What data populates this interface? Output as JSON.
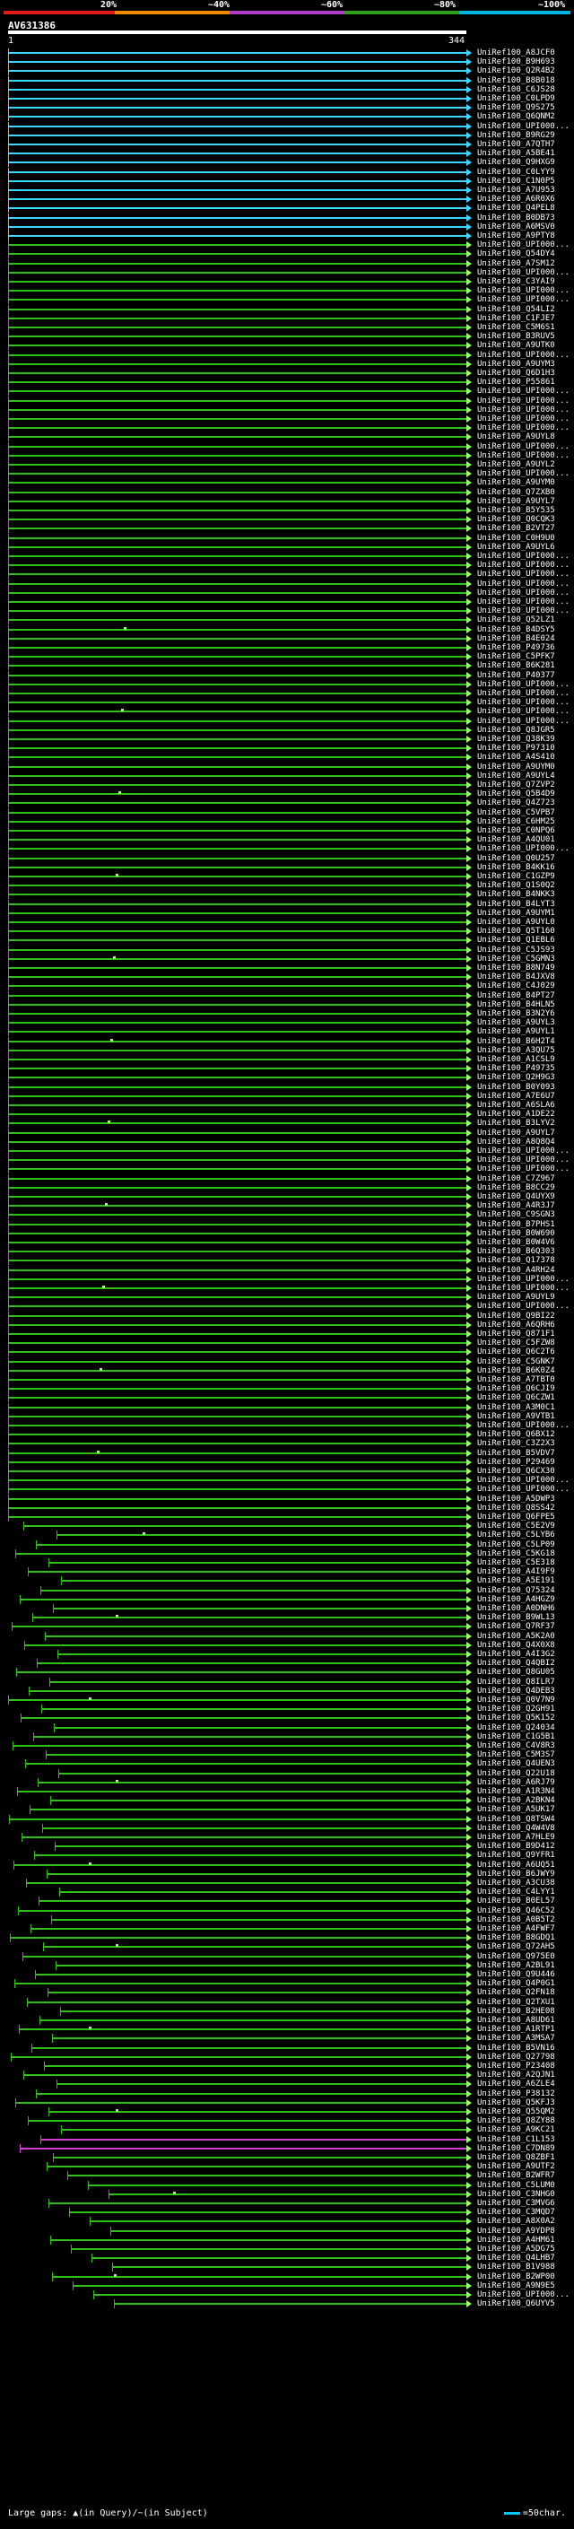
{
  "scale": {
    "labels": [
      "20%",
      "~40%",
      "~60%",
      "~80%",
      "~100%"
    ],
    "colors": [
      "#e11a1a",
      "#f08a00",
      "#b03cc8",
      "#2fa01b",
      "#00b4e0"
    ]
  },
  "query": {
    "name": "AV631386",
    "start": "1",
    "end": "344"
  },
  "colors": {
    "hit_cyan": "#3cd6ff",
    "hit_green": "#2fbf18",
    "hit_magenta": "#d23cd2",
    "arrow": "#9cff6c",
    "tick": "#ffffff"
  },
  "hits": [
    "UniRef100_A8JCF0",
    "UniRef100_B9H693",
    "UniRef100_Q2R4B2",
    "UniRef100_B8B018",
    "UniRef100_C6JS28",
    "UniRef100_C0LPD9",
    "UniRef100_Q9S275",
    "UniRef100_Q6QNM2",
    "UniRef100_UPI000...",
    "UniRef100_B9RG29",
    "UniRef100_A7QTH7",
    "UniRef100_A5BE41",
    "UniRef100_Q9HXG9",
    "UniRef100_C0LYY9",
    "UniRef100_C1N0P5",
    "UniRef100_A7U953",
    "UniRef100_A6R0X6",
    "UniRef100_Q4PEL8",
    "UniRef100_B0DB73",
    "UniRef100_A6MSV0",
    "UniRef100_A9PTY8",
    "UniRef100_UPI000...",
    "UniRef100_Q54DY4",
    "UniRef100_A7SM12",
    "UniRef100_UPI000...",
    "UniRef100_C3YAI9",
    "UniRef100_UPI000...",
    "UniRef100_UPI000...",
    "UniRef100_Q54LI2",
    "UniRef100_C1FJE7",
    "UniRef100_C5M6S1",
    "UniRef100_B3RUV5",
    "UniRef100_A9UTK0",
    "UniRef100_UPI000...",
    "UniRef100_A9UYM3",
    "UniRef100_Q6D1H3",
    "UniRef100_P55861",
    "UniRef100_UPI000...",
    "UniRef100_UPI000...",
    "UniRef100_UPI000...",
    "UniRef100_UPI000...",
    "UniRef100_UPI000...",
    "UniRef100_A9UYL8",
    "UniRef100_UPI000...",
    "UniRef100_UPI000...",
    "UniRef100_A9UYL2",
    "UniRef100_UPI000...",
    "UniRef100_A9UYM0",
    "UniRef100_Q7ZXB0",
    "UniRef100_A9UYL7",
    "UniRef100_B5Y535",
    "UniRef100_Q0CQK3",
    "UniRef100_B2VT27",
    "UniRef100_C0H9U0",
    "UniRef100_A9UYL6",
    "UniRef100_UPI000...",
    "UniRef100_UPI000...",
    "UniRef100_UPI000...",
    "UniRef100_UPI000...",
    "UniRef100_UPI000...",
    "UniRef100_UPI000...",
    "UniRef100_UPI000...",
    "UniRef100_Q52LZ1",
    "UniRef100_B4DSY5",
    "UniRef100_B4E024",
    "UniRef100_P49736",
    "UniRef100_C5PFK7",
    "UniRef100_B6K281",
    "UniRef100_P40377",
    "UniRef100_UPI000...",
    "UniRef100_UPI000...",
    "UniRef100_UPI000...",
    "UniRef100_UPI000...",
    "UniRef100_UPI000...",
    "UniRef100_Q8JGR5",
    "UniRef100_Q38K39",
    "UniRef100_P97310",
    "UniRef100_A4S410",
    "UniRef100_A9UYM0",
    "UniRef100_A9UYL4",
    "UniRef100_Q7ZVP2",
    "UniRef100_Q5B4D9",
    "UniRef100_Q4Z723",
    "UniRef100_C5VPB7",
    "UniRef100_C6HM25",
    "UniRef100_C0NPQ6",
    "UniRef100_A4QU01",
    "UniRef100_UPI000...",
    "UniRef100_Q0U257",
    "UniRef100_B4KK16",
    "UniRef100_C1GZP9",
    "UniRef100_Q1S0Q2",
    "UniRef100_B4NKK3",
    "UniRef100_B4LYT3",
    "UniRef100_A9UYM1",
    "UniRef100_A9UYL0",
    "UniRef100_Q5T160",
    "UniRef100_Q1EBL6",
    "UniRef100_C5JS93",
    "UniRef100_C5GMN3",
    "UniRef100_B8N749",
    "UniRef100_B4JXV8",
    "UniRef100_C4J029",
    "UniRef100_B4PT27",
    "UniRef100_B4HLN5",
    "UniRef100_B3N2Y6",
    "UniRef100_A9UYL3",
    "UniRef100_A9UYL1",
    "UniRef100_B6H2T4",
    "UniRef100_A3QU75",
    "UniRef100_A1CSL9",
    "UniRef100_P49735",
    "UniRef100_Q2H9G3",
    "UniRef100_B0Y093",
    "UniRef100_A7E6U7",
    "UniRef100_A6SLA6",
    "UniRef100_A1DE22",
    "UniRef100_B3LYV2",
    "UniRef100_A9UYL7",
    "UniRef100_A8Q8Q4",
    "UniRef100_UPI000...",
    "UniRef100_UPI000...",
    "UniRef100_UPI000...",
    "UniRef100_C7Z967",
    "UniRef100_B8CC29",
    "UniRef100_Q4UYX9",
    "UniRef100_A4R3J7",
    "UniRef100_C9SGN3",
    "UniRef100_B7PHS1",
    "UniRef100_B0W690",
    "UniRef100_B0W4V6",
    "UniRef100_B6Q303",
    "UniRef100_Q17378",
    "UniRef100_A4RH24",
    "UniRef100_UPI000...",
    "UniRef100_UPI000...",
    "UniRef100_A9UYL9",
    "UniRef100_UPI000...",
    "UniRef100_Q9BI22",
    "UniRef100_A6QRH6",
    "UniRef100_Q871F1",
    "UniRef100_C5FZW8",
    "UniRef100_Q6C2T6",
    "UniRef100_C5GNK7",
    "UniRef100_B6K0Z4",
    "UniRef100_A7TBT0",
    "UniRef100_Q6CJI9",
    "UniRef100_Q6CZW1",
    "UniRef100_A3M0C1",
    "UniRef100_A9VTB1",
    "UniRef100_UPI000...",
    "UniRef100_Q6BX12",
    "UniRef100_C3Z2X3",
    "UniRef100_B5VDV7",
    "UniRef100_P29469",
    "UniRef100_Q6CX30",
    "UniRef100_UPI000...",
    "UniRef100_UPI000...",
    "UniRef100_A5DWP3",
    "UniRef100_Q8SS42",
    "UniRef100_Q6FPE5",
    "UniRef100_C5E2V9",
    "UniRef100_C5LYB6",
    "UniRef100_C5LP09",
    "UniRef100_C5KG18",
    "UniRef100_C5E318",
    "UniRef100_A4I9F9",
    "UniRef100_A5E191",
    "UniRef100_Q75324",
    "UniRef100_A4HGZ9",
    "UniRef100_A0DNH6",
    "UniRef100_B9WL13",
    "UniRef100_Q7RF37",
    "UniRef100_A5K2A0",
    "UniRef100_Q4X0X8",
    "UniRef100_A4I3G2",
    "UniRef100_Q4QBI2",
    "UniRef100_Q8GU05",
    "UniRef100_Q8ILR7",
    "UniRef100_Q4DEB3",
    "UniRef100_Q0V7N9",
    "UniRef100_Q2GH91",
    "UniRef100_Q5K152",
    "UniRef100_Q24034",
    "UniRef100_C1G5B1",
    "UniRef100_C4V8R3",
    "UniRef100_C5M3S7",
    "UniRef100_Q4UEN3",
    "UniRef100_Q22U18",
    "UniRef100_A6RJ79",
    "UniRef100_A1R3N4",
    "UniRef100_A2BKN4",
    "UniRef100_A5UK17",
    "UniRef100_Q8TSW4",
    "UniRef100_Q4W4V8",
    "UniRef100_A7HLE9",
    "UniRef100_B9D412",
    "UniRef100_Q9YFR1",
    "UniRef100_A6UQ51",
    "UniRef100_B6JWY9",
    "UniRef100_A3CU38",
    "UniRef100_C4LYY1",
    "UniRef100_B0EL57",
    "UniRef100_Q46C52",
    "UniRef100_A0B5T2",
    "UniRef100_A4FWF7",
    "UniRef100_B8GDQ1",
    "UniRef100_Q72AH5",
    "UniRef100_Q975E0",
    "UniRef100_A2BL91",
    "UniRef100_Q9U446",
    "UniRef100_Q4P0G1",
    "UniRef100_Q2FN18",
    "UniRef100_Q2TXU1",
    "UniRef100_B2HE08",
    "UniRef100_A8UD61",
    "UniRef100_A1RTP1",
    "UniRef100_A3MSA7",
    "UniRef100_B5VN16",
    "UniRef100_Q27798",
    "UniRef100_P23408",
    "UniRef100_A2QJN1",
    "UniRef100_A6ZLE4",
    "UniRef100_P38132",
    "UniRef100_Q5KFJ3",
    "UniRef100_Q55QM2",
    "UniRef100_Q8ZY88",
    "UniRef100_A9KC21",
    "UniRef100_C1L153",
    "UniRef100_C7DN89",
    "UniRef100_Q8ZBF1",
    "UniRef100_A9UTF2",
    "UniRef100_B2WFR7",
    "UniRef100_C5LUM0",
    "UniRef100_C3NHG0",
    "UniRef100_C3MVG6",
    "UniRef100_C3MQD7",
    "UniRef100_A8X0A2",
    "UniRef100_A9YDP8",
    "UniRef100_A4HM61",
    "UniRef100_A5DG75",
    "UniRef100_Q4LHB7",
    "UniRef100_B1V988",
    "UniRef100_B2WP00",
    "UniRef100_A9N9E5",
    "UniRef100_UPI000...",
    "UniRef100_Q6UYV5"
  ],
  "legend": {
    "text": "Large gaps: ▲(in Query)/~(in Subject)",
    "scale": "=50char."
  }
}
